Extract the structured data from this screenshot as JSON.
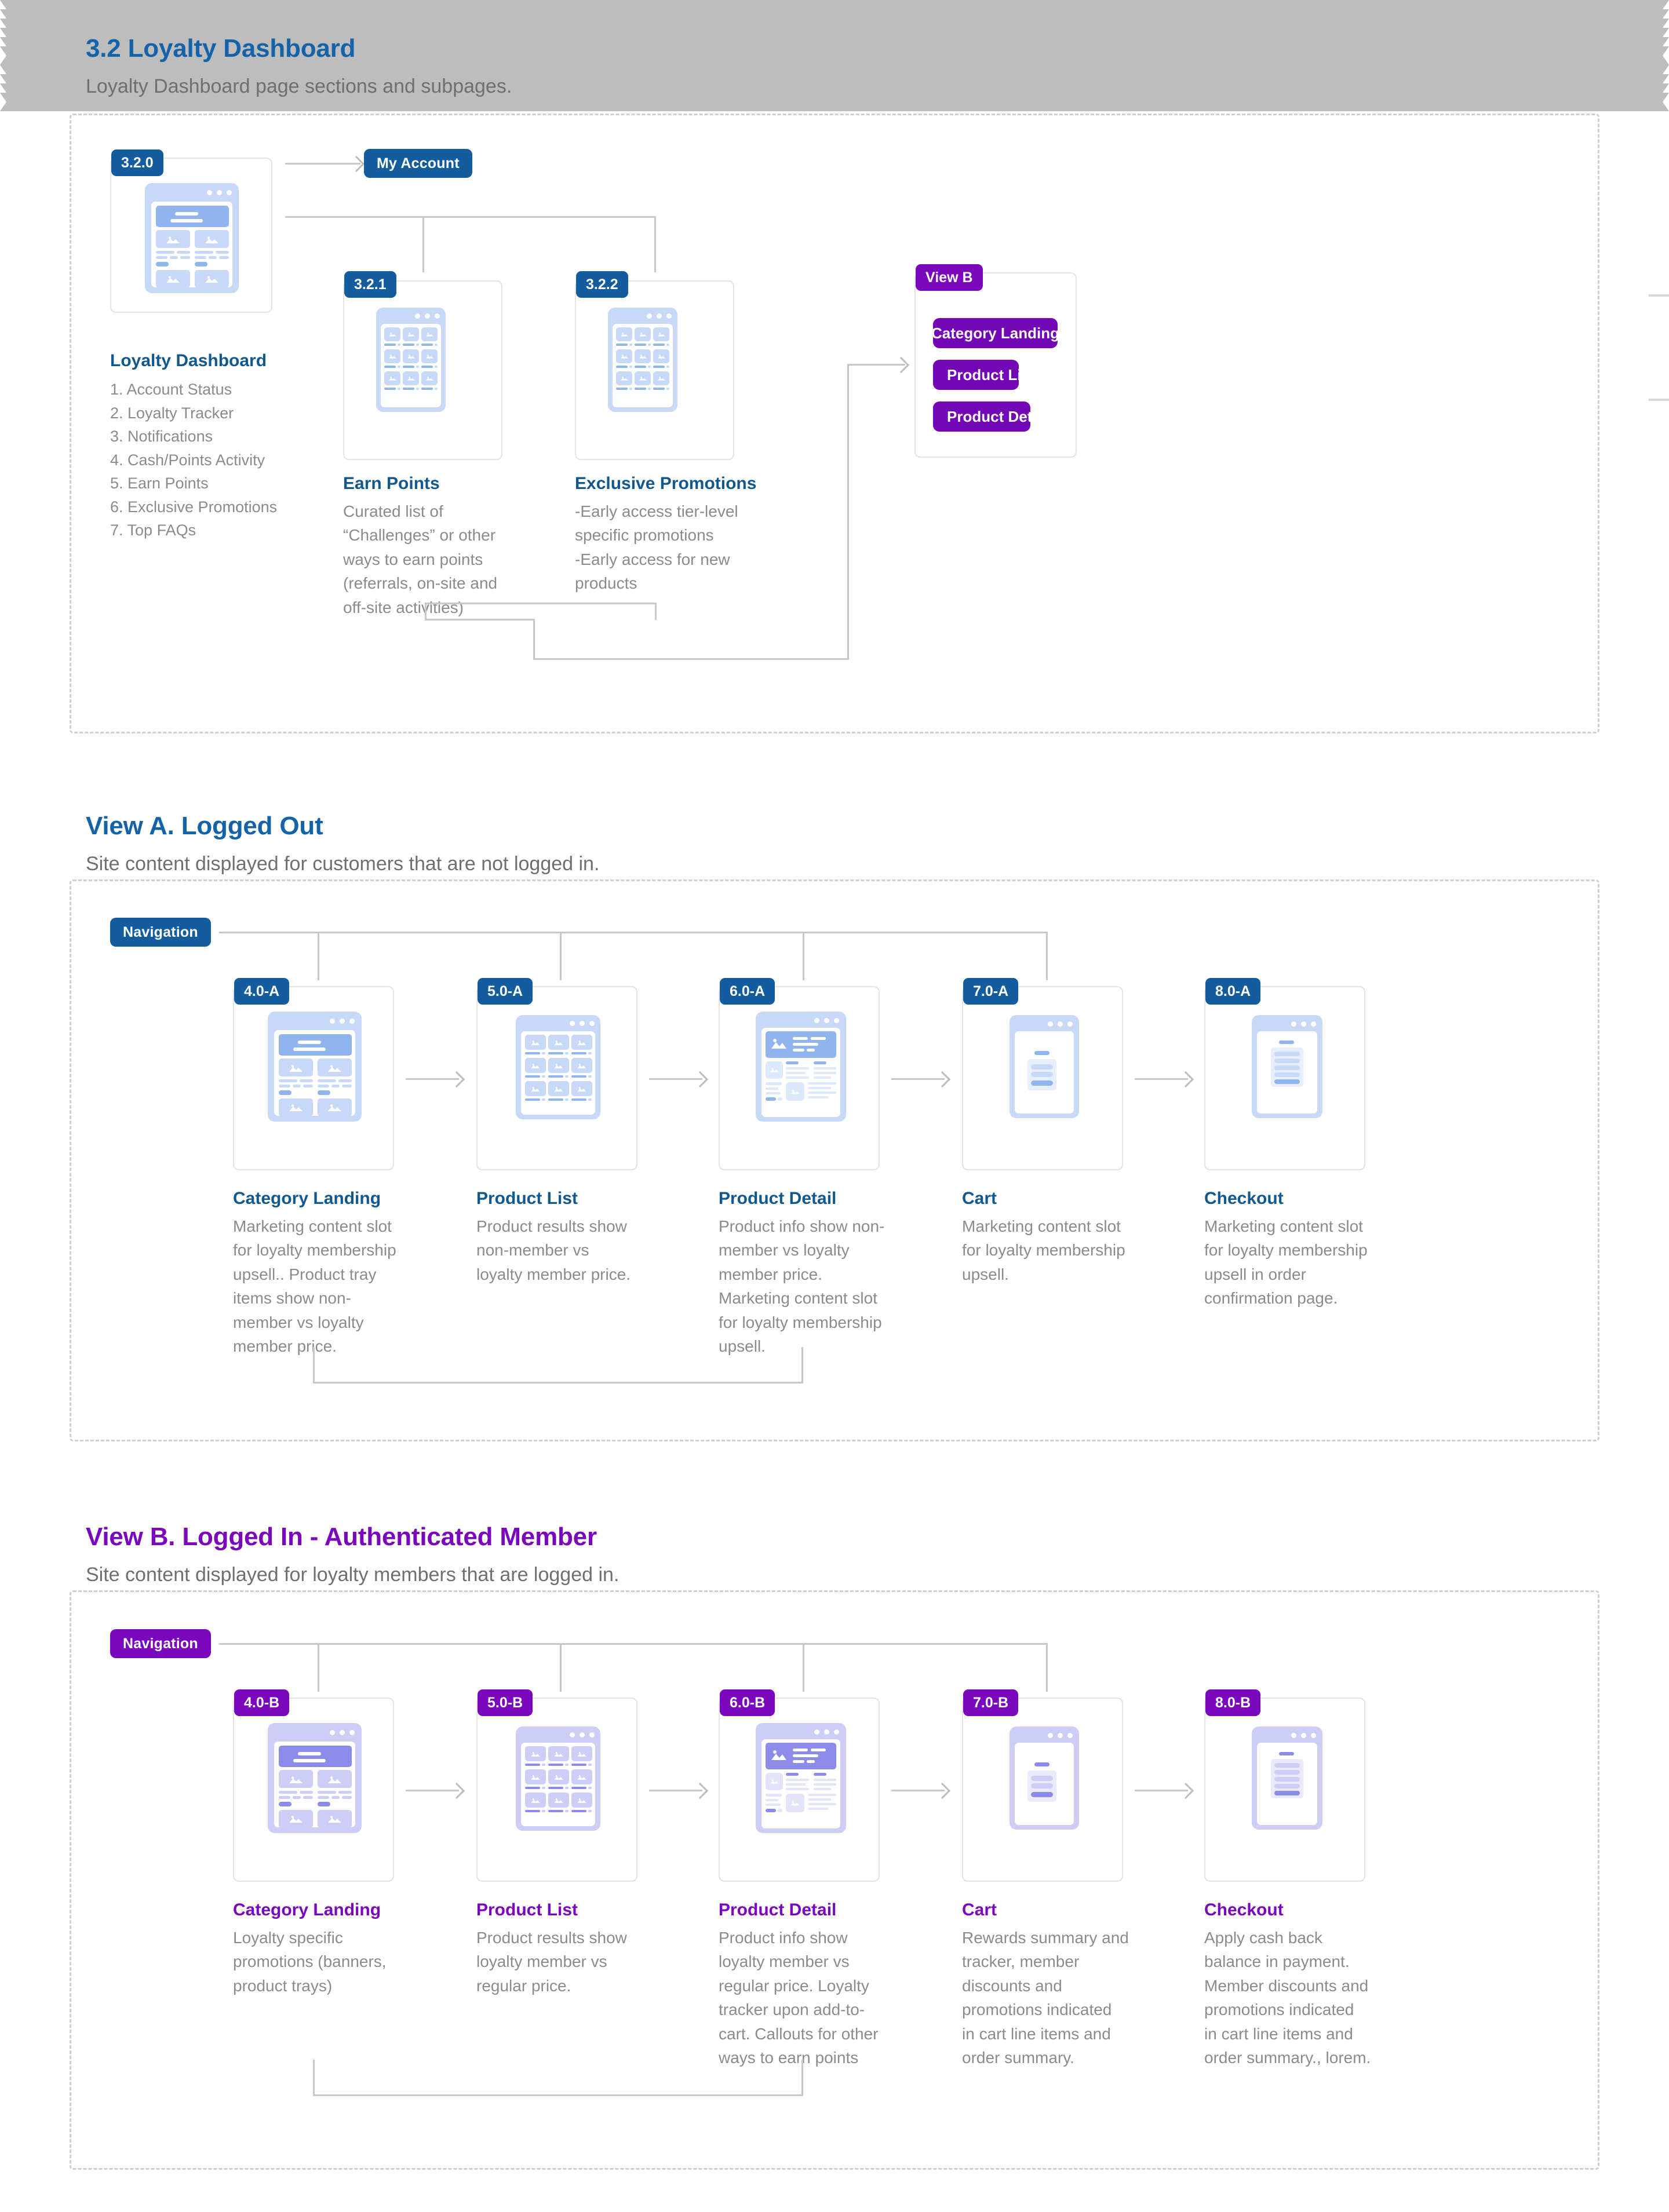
{
  "sections": [
    {
      "id": "3.2",
      "title": "3.2 Loyalty Dashboard",
      "subtitle": "Loyalty Dashboard page sections and subpages."
    },
    {
      "id": "view-a",
      "title": "View A. Logged Out",
      "subtitle": "Site content displayed for customers that are not logged in."
    },
    {
      "id": "view-b",
      "title": "View B. Logged In - Authenticated Member",
      "subtitle": "Site content displayed for loyalty members that are logged in."
    }
  ],
  "dashboard": {
    "badge": "3.2.0",
    "title": "Loyalty Dashboard",
    "items": [
      "1. Account Status",
      "2. Loyalty Tracker",
      "3. Notifications",
      "4. Cash/Points Activity",
      "5. Earn Points",
      "6. Exclusive Promotions",
      "7. Top FAQs"
    ],
    "my_account_pill": "My Account",
    "subnodes": [
      {
        "badge": "3.2.1",
        "title": "Earn Points",
        "desc": "Curated list of\n“Challenges” or other\nways to earn points\n(referrals, on-site and\noff-site activities)"
      },
      {
        "badge": "3.2.2",
        "title": "Exclusive Promotions",
        "desc": "-Early access tier-level\nspecific promotions\n-Early access for new\nproducts"
      }
    ],
    "view_b_panel": {
      "badge": "View B",
      "buttons": [
        "Category Landing",
        "Product List",
        "Product Detail"
      ]
    }
  },
  "view_a": {
    "nav_pill": "Navigation",
    "nodes": [
      {
        "badge": "4.0-A",
        "title": "Category Landing",
        "desc": "Marketing content slot\nfor loyalty membership\nupsell.. Product tray\nitems show non-\nmember vs loyalty\nmember price.",
        "mock": "category"
      },
      {
        "badge": "5.0-A",
        "title": "Product List",
        "desc": "Product results show\nnon-member vs\nloyalty member price.",
        "mock": "grid"
      },
      {
        "badge": "6.0-A",
        "title": "Product Detail",
        "desc": "Product info show non-\nmember vs loyalty\nmember price.\nMarketing content slot\nfor loyalty membership\nupsell.",
        "mock": "detail"
      },
      {
        "badge": "7.0-A",
        "title": "Cart",
        "desc": "Marketing content slot\nfor loyalty membership\nupsell.",
        "mock": "cart"
      },
      {
        "badge": "8.0-A",
        "title": "Checkout",
        "desc": "Marketing content slot\nfor loyalty membership\nupsell in order\nconfirmation page.",
        "mock": "checkout"
      }
    ]
  },
  "view_b": {
    "nav_pill": "Navigation",
    "nodes": [
      {
        "badge": "4.0-B",
        "title": "Category Landing",
        "desc": "Loyalty specific\npromotions (banners,\nproduct trays)",
        "mock": "category"
      },
      {
        "badge": "5.0-B",
        "title": "Product List",
        "desc": "Product results show\nloyalty member vs\nregular price.",
        "mock": "grid"
      },
      {
        "badge": "6.0-B",
        "title": "Product Detail",
        "desc": "Product info show\nloyalty member vs\nregular price. Loyalty\ntracker upon add-to-\ncart. Callouts for other\nways to earn points",
        "mock": "detail"
      },
      {
        "badge": "7.0-B",
        "title": "Cart",
        "desc": "Rewards summary and\ntracker, member\ndiscounts and\npromotions indicated\nin cart line items and\norder summary.",
        "mock": "cart"
      },
      {
        "badge": "8.0-B",
        "title": "Checkout",
        "desc": "Apply cash back\nbalance in payment.\nMember discounts and\npromotions indicated\nin cart line items and\norder summary., lorem.",
        "mock": "checkout"
      }
    ]
  },
  "colors": {
    "blue": "#135d9e",
    "blue_text": "#11588f",
    "purple": "#7a06bd",
    "purple_btn": "#7306b5",
    "gray_text": "#8b8b8b",
    "line": "#c8c8c8",
    "card_border": "#e3e3e3",
    "wire_blue": "#c7d9f7",
    "wire_purple": "#cdcdf5"
  }
}
